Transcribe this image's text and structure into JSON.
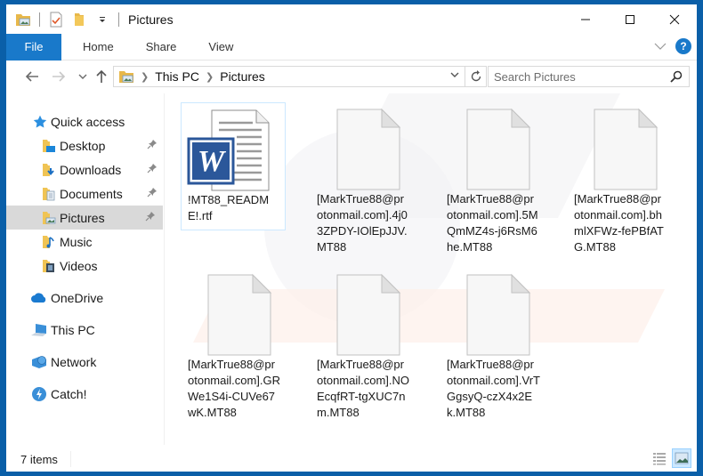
{
  "window": {
    "title": "Pictures",
    "colors": {
      "frame": "#0a5fa8",
      "accent": "#1979ca",
      "selection": "#cce8ff",
      "nav_selected": "#d9d9d9"
    }
  },
  "quick_access_toolbar": {
    "icons": [
      "pictures-folder-icon",
      "properties-icon",
      "new-folder-icon",
      "customize-dropdown-icon"
    ]
  },
  "window_controls": {
    "minimize": "minimize-icon",
    "maximize": "maximize-icon",
    "close": "close-icon"
  },
  "ribbon": {
    "file_label": "File",
    "tabs": [
      {
        "label": "Home"
      },
      {
        "label": "Share"
      },
      {
        "label": "View"
      }
    ],
    "expand_icon": "chevron-down-icon",
    "help_label": "?"
  },
  "navigation": {
    "back_icon": "arrow-left-icon",
    "forward_icon": "arrow-right-icon",
    "recent_icon": "chevron-down-icon",
    "up_icon": "arrow-up-icon",
    "breadcrumb": [
      {
        "label": "This PC"
      },
      {
        "label": "Pictures"
      }
    ],
    "search_placeholder": "Search Pictures"
  },
  "sidebar": {
    "items": [
      {
        "label": "Quick access",
        "icon": "star-icon"
      },
      {
        "label": "Desktop",
        "icon": "desktop-folder-icon",
        "pinned": true
      },
      {
        "label": "Downloads",
        "icon": "downloads-folder-icon",
        "pinned": true
      },
      {
        "label": "Documents",
        "icon": "documents-folder-icon",
        "pinned": true
      },
      {
        "label": "Pictures",
        "icon": "pictures-folder-icon",
        "pinned": true,
        "selected": true
      },
      {
        "label": "Music",
        "icon": "music-folder-icon"
      },
      {
        "label": "Videos",
        "icon": "videos-folder-icon"
      },
      {
        "label": "OneDrive",
        "icon": "cloud-icon"
      },
      {
        "label": "This PC",
        "icon": "computer-icon"
      },
      {
        "label": "Network",
        "icon": "network-icon"
      },
      {
        "label": "Catch!",
        "icon": "catch-icon"
      }
    ]
  },
  "files": [
    {
      "name": "!MT88_README!.rtf",
      "type": "word-document"
    },
    {
      "name": "[MarkTrue88@protonmail.com].4j03ZPDY-IOlEpJJV.MT88",
      "type": "blank"
    },
    {
      "name": "[MarkTrue88@protonmail.com].5MQmMZ4s-j6RsM6he.MT88",
      "type": "blank"
    },
    {
      "name": "[MarkTrue88@protonmail.com].bhmlXFWz-fePBfATG.MT88",
      "type": "blank"
    },
    {
      "name": "[MarkTrue88@protonmail.com].GRWe1S4i-CUVe67wK.MT88",
      "type": "blank"
    },
    {
      "name": "[MarkTrue88@protonmail.com].NOEcqfRT-tgXUC7nm.MT88",
      "type": "blank"
    },
    {
      "name": "[MarkTrue88@protonmail.com].VrTGgsyQ-czX4x2Ek.MT88",
      "type": "blank"
    }
  ],
  "status_bar": {
    "item_count": "7 items",
    "views": [
      {
        "name": "details-view-icon",
        "active": false
      },
      {
        "name": "large-icons-view-icon",
        "active": true
      }
    ]
  }
}
